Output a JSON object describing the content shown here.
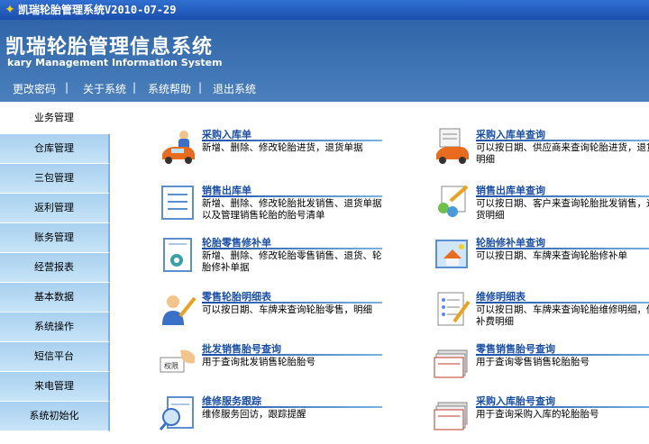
{
  "window": {
    "title": "凯瑞轮胎管理系统V2010-07-29"
  },
  "header": {
    "title": "凯瑞轮胎管理信息系统",
    "subtitle": "kary Management Information System",
    "menu": [
      "更改密码",
      "|",
      "关于系统",
      "|",
      "系统帮助",
      "|",
      "退出系统"
    ]
  },
  "sidebar": {
    "items": [
      {
        "label": "业务管理",
        "active": true
      },
      {
        "label": "仓库管理"
      },
      {
        "label": "三包管理"
      },
      {
        "label": "返利管理"
      },
      {
        "label": "账务管理"
      },
      {
        "label": "经营报表"
      },
      {
        "label": "基本数据"
      },
      {
        "label": "系统操作"
      },
      {
        "label": "短信平台"
      },
      {
        "label": "来电管理"
      },
      {
        "label": "系统初始化"
      }
    ]
  },
  "entries": [
    {
      "title": "采购入库单",
      "desc": "新增、删除、修改轮胎进货，退货单据",
      "icon": "car-person-icon"
    },
    {
      "title": "采购入库单查询",
      "desc": "可以按日期、供应商来查询轮胎进货，退货明细",
      "icon": "car-document-icon"
    },
    {
      "title": "销售出库单",
      "desc": "新增、删除、修改轮胎批发销售、退货单据以及管理销售轮胎的胎号清单",
      "icon": "list-document-icon"
    },
    {
      "title": "销售出库单查询",
      "desc": "可以按日期、客户来查询轮胎批发销售，退货明细",
      "icon": "people-pencil-icon"
    },
    {
      "title": "轮胎零售修补单",
      "desc": "新增、删除、修改轮胎零售销售、退货、轮胎修补单据",
      "icon": "repair-document-icon"
    },
    {
      "title": "轮胎修补单查询",
      "desc": "可以按日期、车牌来查询轮胎修补单",
      "icon": "house-picture-icon"
    },
    {
      "title": "零售轮胎明细表",
      "desc": "可以按日期、车牌来查询轮胎零售，明细",
      "icon": "person-pencil-icon"
    },
    {
      "title": "维修明细表",
      "desc": "可以按日期、车牌来查询轮胎维修明细，修补费明细",
      "icon": "checklist-pencil-icon"
    },
    {
      "title": "批发销售胎号查询",
      "desc": "用于查询批发销售轮胎胎号",
      "icon": "hand-card-icon"
    },
    {
      "title": "零售销售胎号查询",
      "desc": "用于查询零售销售轮胎胎号",
      "icon": "stacked-papers-icon"
    },
    {
      "title": "维修服务跟踪",
      "desc": "维修服务回访，跟踪提醒",
      "icon": "magnifier-document-icon"
    },
    {
      "title": "采购入库胎号查询",
      "desc": "用于查询采购入库的轮胎胎号",
      "icon": "stacked-papers-icon"
    }
  ],
  "colors": {
    "titlebar": "#1c4fae",
    "header": "#3a70b0",
    "sidebar": "#b5dbf3",
    "link": "#1a4fa8"
  }
}
